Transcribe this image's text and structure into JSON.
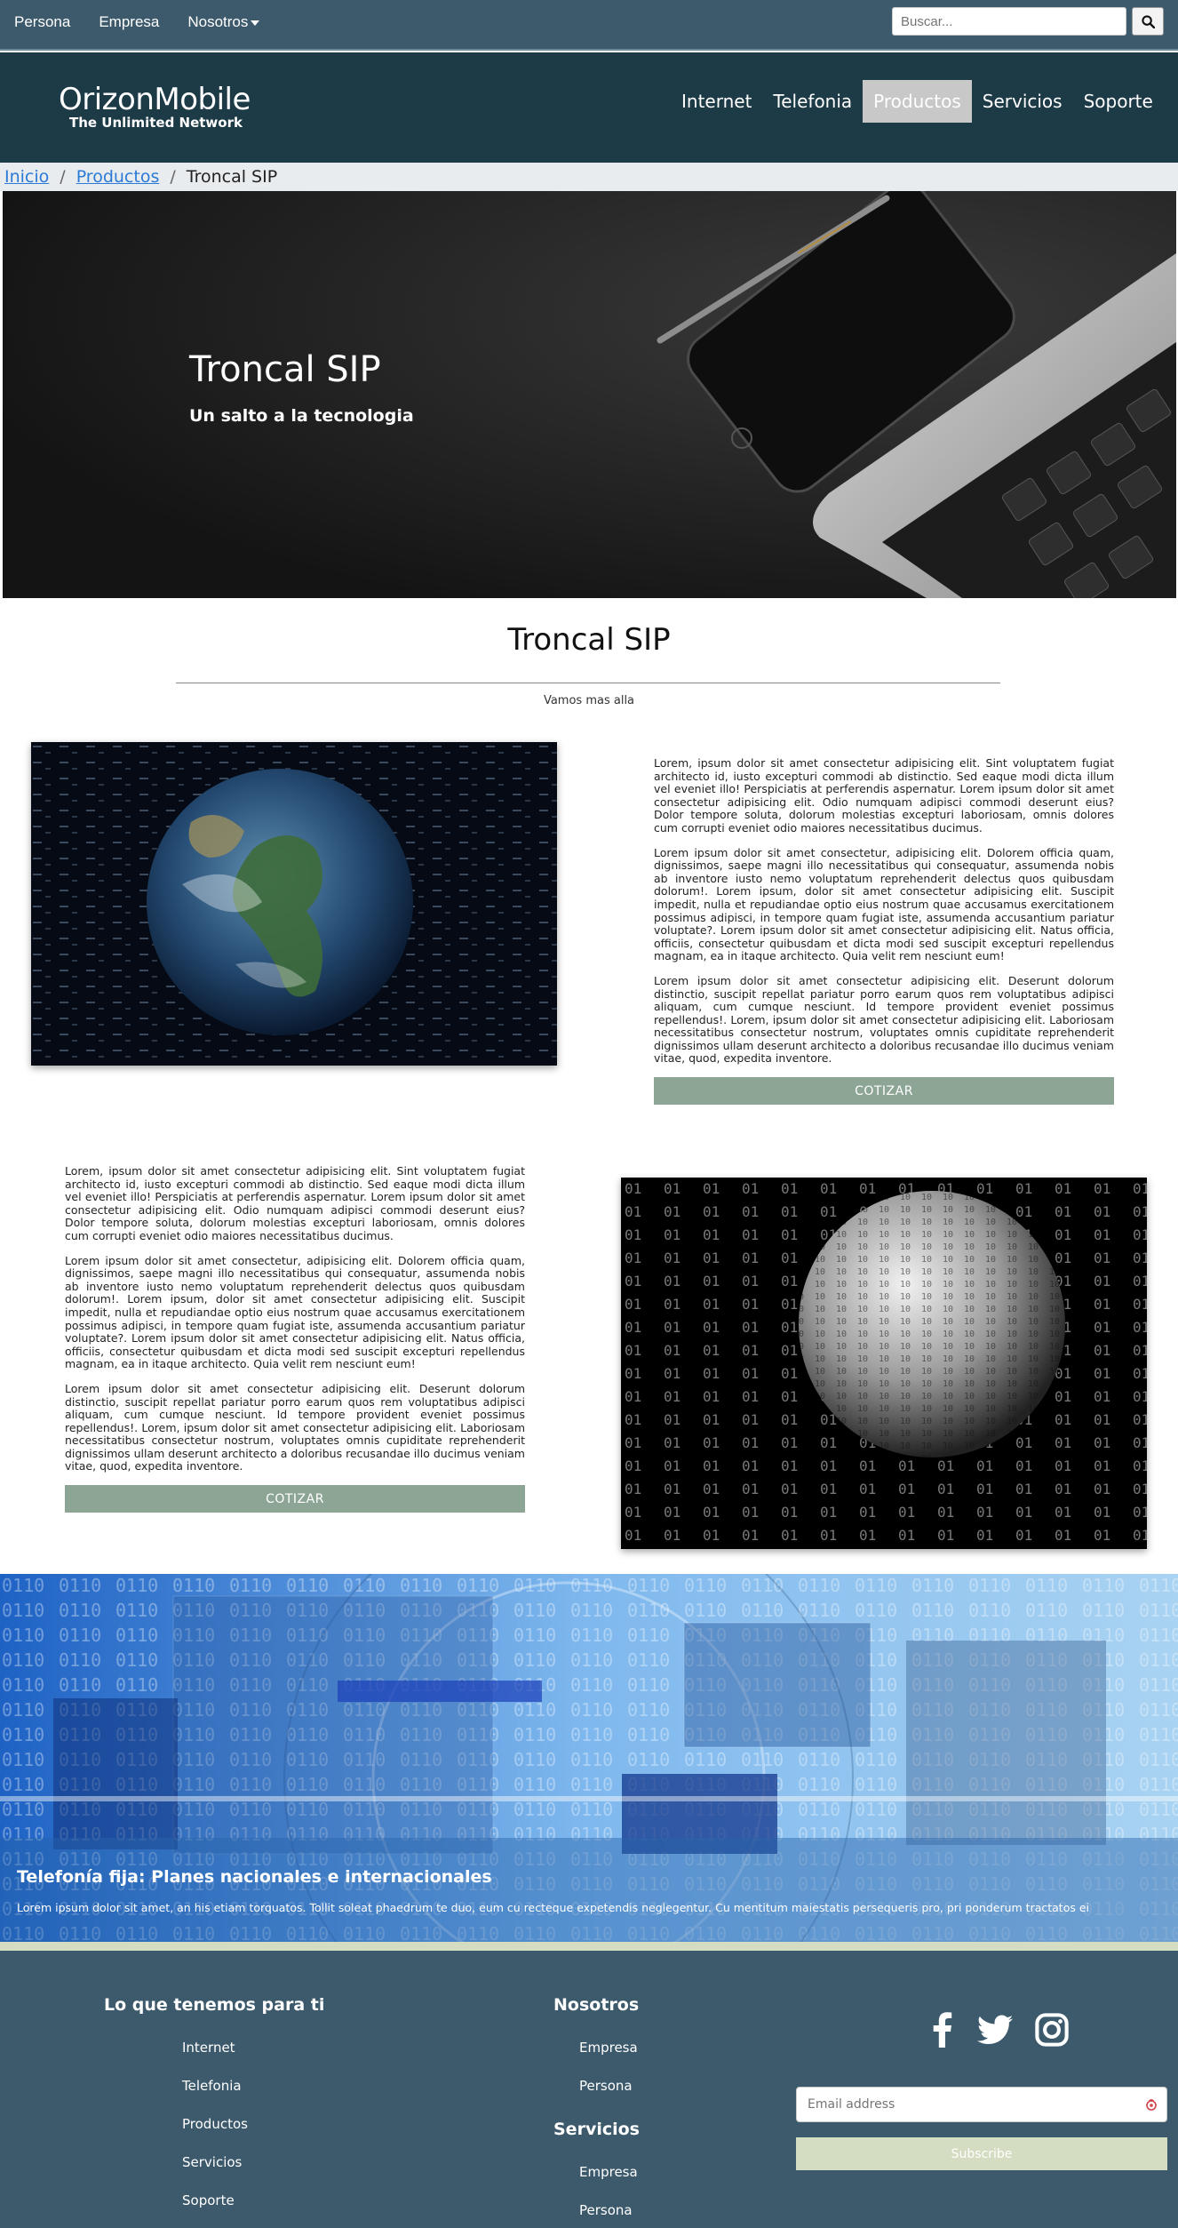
{
  "topbar": {
    "links": [
      "Persona",
      "Empresa",
      "Nosotros"
    ],
    "search_placeholder": "Buscar..."
  },
  "brand": {
    "name": "OrizonMobile",
    "tagline": "The Unlimited Network"
  },
  "nav": {
    "items": [
      "Internet",
      "Telefonia",
      "Productos",
      "Servicios",
      "Soporte"
    ],
    "active": "Productos"
  },
  "breadcrumb": {
    "home": "Inicio",
    "parent": "Productos",
    "current": "Troncal SIP"
  },
  "hero": {
    "title": "Troncal SIP",
    "subtitle": "Un salto a la tecnologia"
  },
  "section": {
    "title": "Troncal SIP",
    "subtitle": "Vamos mas alla"
  },
  "content": {
    "paragraphs": [
      "Lorem, ipsum dolor sit amet consectetur adipisicing elit. Sint voluptatem fugiat architecto id, iusto excepturi commodi ab distinctio. Sed eaque modi dicta illum vel eveniet illo! Perspiciatis at perferendis aspernatur. Lorem ipsum dolor sit amet consectetur adipisicing elit. Odio numquam adipisci commodi deserunt eius? Dolor tempore soluta, dolorum molestias excepturi laboriosam, omnis dolores cum corrupti eveniet odio maiores necessitatibus ducimus.",
      "Lorem ipsum dolor sit amet consectetur, adipisicing elit. Dolorem officia quam, dignissimos, saepe magni illo necessitatibus qui consequatur, assumenda nobis ab inventore iusto nemo voluptatum reprehenderit delectus quos quibusdam dolorum!. Lorem ipsum, dolor sit amet consectetur adipisicing elit. Suscipit impedit, nulla et repudiandae optio eius nostrum quae accusamus exercitationem possimus adipisci, in tempore quam fugiat iste, assumenda accusantium pariatur voluptate?. Lorem ipsum dolor sit amet consectetur adipisicing elit. Natus officia, officiis, consectetur quibusdam et dicta modi sed suscipit excepturi repellendus magnam, ea in itaque architecto. Quia velit rem nesciunt eum!",
      "Lorem ipsum dolor sit amet consectetur adipisicing elit. Deserunt dolorum distinctio, suscipit repellat pariatur porro earum quos rem voluptatibus adipisci aliquam, cum cumque nesciunt. Id tempore provident eveniet possimus repellendus!. Lorem, ipsum dolor sit amet consectetur adipisicing elit. Laboriosam necessitatibus consectetur nostrum, voluptates omnis cupiditate reprehenderit dignissimos ullam deserunt architecto a doloribus recusandae illo ducimus veniam vitae, quod, expedita inventore."
    ],
    "cta_label": "COTIZAR"
  },
  "banner": {
    "title": "Telefonía fija: Planes nacionales e internacionales",
    "text": "Lorem ipsum dolor sit amet, an his etiam torquatos. Tollit soleat phaedrum te duo, eum cu recteque expetendis neglegentur. Cu mentitum maiestatis persequeris pro, pri ponderum tractatos ei"
  },
  "footer": {
    "col1": {
      "heading": "Lo que tenemos para ti",
      "links": [
        "Internet",
        "Telefonia",
        "Productos",
        "Servicios",
        "Soporte"
      ]
    },
    "col2": {
      "heading": "Nosotros",
      "links": [
        "Empresa",
        "Persona"
      ]
    },
    "col3": {
      "heading": "Servicios",
      "links": [
        "Empresa",
        "Persona"
      ]
    },
    "email_placeholder": "Email address",
    "subscribe_label": "Subscribe",
    "social": [
      "facebook-icon",
      "twitter-icon",
      "instagram-icon"
    ]
  },
  "colors": {
    "topbar": "#3d5a6c",
    "nav": "#1d3a47",
    "active_nav": "#c8c8c8",
    "cta": "#8ca595",
    "subscribe": "#d4dcc2",
    "link": "#2a7ad6"
  }
}
